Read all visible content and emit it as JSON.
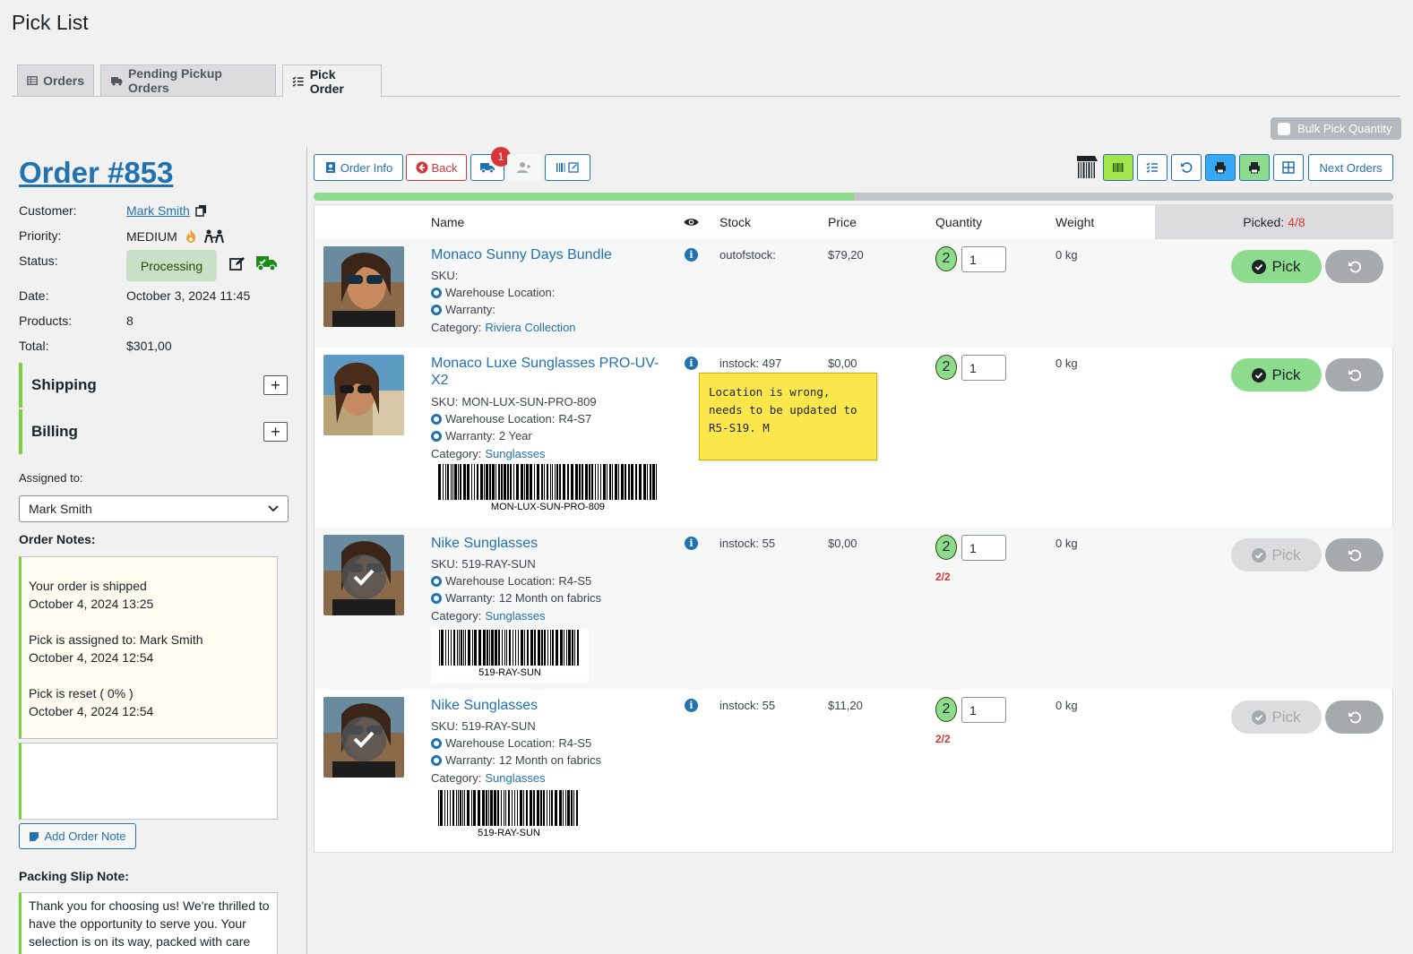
{
  "page": {
    "title": "Pick List"
  },
  "tabs": [
    {
      "label": "Orders",
      "icon": "table-icon"
    },
    {
      "label": "Pending Pickup Orders",
      "icon": "truck-icon"
    },
    {
      "label": "Pick Order",
      "icon": "checklist-icon",
      "active": true
    }
  ],
  "bulk_pick": {
    "label": "Bulk Pick Quantity",
    "checked": false
  },
  "order": {
    "title": "Order #853",
    "customer_label": "Customer:",
    "customer": "Mark Smith",
    "priority_label": "Priority:",
    "priority": "MEDIUM",
    "status_label": "Status:",
    "status": "Processing",
    "date_label": "Date:",
    "date": "October 3, 2024 11:45",
    "products_label": "Products:",
    "products": "8",
    "total_label": "Total:",
    "total": "$301,00"
  },
  "accordions": {
    "shipping": "Shipping",
    "billing": "Billing"
  },
  "assigned": {
    "label": "Assigned to:",
    "value": "Mark Smith"
  },
  "order_notes": {
    "label": "Order Notes:",
    "notes": [
      {
        "text": "Your order is shipped",
        "date": "October 4, 2024 13:25"
      },
      {
        "text": "Pick is assigned to: Mark Smith",
        "date": "October 4, 2024 12:54"
      },
      {
        "text": "Pick is reset ( 0% )",
        "date": "October 4, 2024 12:54"
      }
    ],
    "add_label": "Add Order Note"
  },
  "packing_slip": {
    "label": "Packing Slip Note:",
    "text": "Thank you for choosing us! We're thrilled to have the opportunity to serve you. Your selection is on its way, packed with care"
  },
  "toolbar": {
    "order_info": "Order Info",
    "back": "Back",
    "ship_badge": "1",
    "next_orders": "Next Orders"
  },
  "progress": {
    "fraction": 0.5
  },
  "table": {
    "headers": {
      "name": "Name",
      "stock": "Stock",
      "price": "Price",
      "quantity": "Quantity",
      "weight": "Weight"
    },
    "picked_label": "Picked:",
    "picked_count": "4/8",
    "pick_label": "Pick",
    "sku_label": "SKU:",
    "warehouse_label": "Warehouse Location:",
    "warranty_label": "Warranty:",
    "category_label": "Category:"
  },
  "items": [
    {
      "name": "Monaco Sunny Days Bundle",
      "sku": "",
      "location": "",
      "warranty": "",
      "category": "Riviera Collection",
      "stock": "outofstock:",
      "price": "$79,20",
      "qty_badge": "2",
      "qty": "1",
      "weight": "0 kg",
      "picked": false,
      "barcode": "",
      "qty_progress": ""
    },
    {
      "name": "Monaco Luxe Sunglasses PRO-UV-X2",
      "sku": "MON-LUX-SUN-PRO-809",
      "location": "R4-S7",
      "warranty": "2 Year",
      "category": "Sunglasses",
      "stock": "instock: 497",
      "price": "$0,00",
      "qty_badge": "2",
      "qty": "1",
      "weight": "0 kg",
      "picked": false,
      "barcode": "MON-LUX-SUN-PRO-809",
      "qty_progress": "",
      "note": "Location is wrong, needs to be updated to R5-S19. M"
    },
    {
      "name": "Nike Sunglasses",
      "sku": "519-RAY-SUN",
      "location": "R4-S5",
      "warranty": "12 Month on fabrics",
      "category": "Sunglasses",
      "stock": "instock: 55",
      "price": "$0,00",
      "qty_badge": "2",
      "qty": "1",
      "weight": "0 kg",
      "picked": true,
      "barcode": "519-RAY-SUN",
      "qty_progress": "2/2"
    },
    {
      "name": "Nike Sunglasses",
      "sku": "519-RAY-SUN",
      "location": "R4-S5",
      "warranty": "12 Month on fabrics",
      "category": "Sunglasses",
      "stock": "instock: 55",
      "price": "$11,20",
      "qty_badge": "2",
      "qty": "1",
      "weight": "0 kg",
      "picked": true,
      "barcode": "519-RAY-SUN",
      "qty_progress": "2/2"
    }
  ],
  "colors": {
    "accent": "#2271b1",
    "pick_green": "#8ddc8d",
    "status_bg": "#c6e1c6",
    "note_yellow": "#fbe74b",
    "alert_red": "#d63638"
  }
}
